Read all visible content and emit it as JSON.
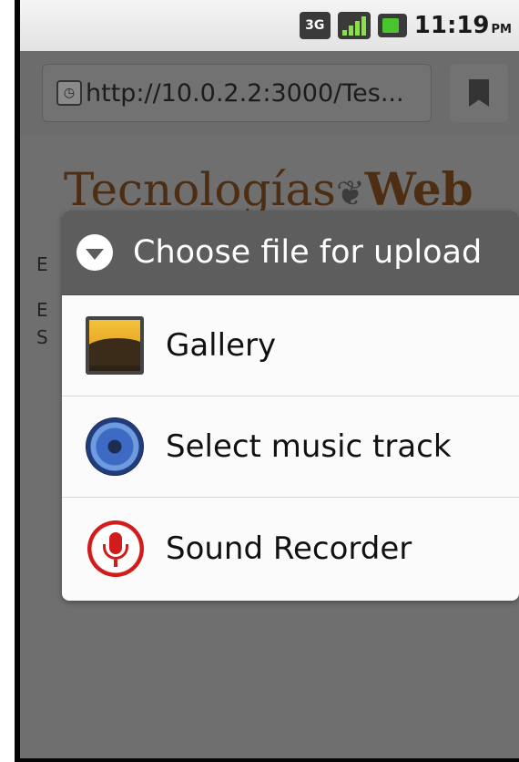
{
  "status_bar": {
    "network_label": "3G",
    "time": "11:19",
    "ampm": "PM",
    "icons": [
      "3g-icon",
      "signal-icon",
      "battery-icon"
    ]
  },
  "browser": {
    "url": "http://10.0.2.2:3000/Tes...",
    "icons": [
      "page-icon",
      "bookmark-icon"
    ]
  },
  "page": {
    "header_light": "Tecnologías",
    "header_bold": "Web",
    "side_letters": [
      "E",
      "E",
      "S"
    ]
  },
  "dialog": {
    "title": "Choose file for upload",
    "options": [
      {
        "label": "Gallery",
        "icon": "gallery-icon"
      },
      {
        "label": "Select music track",
        "icon": "music-icon"
      },
      {
        "label": "Sound Recorder",
        "icon": "microphone-icon"
      }
    ]
  },
  "colors": {
    "dialog_header": "#5d5d5d",
    "overlay": "#6f6f6f",
    "mic_red": "#d21b1b",
    "header_brown": "#4e2e12"
  }
}
